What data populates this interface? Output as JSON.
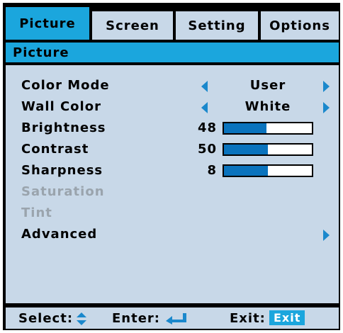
{
  "tabs": [
    {
      "label": "Picture",
      "active": true
    },
    {
      "label": "Screen",
      "active": false
    },
    {
      "label": "Setting",
      "active": false
    },
    {
      "label": "Options",
      "active": false
    }
  ],
  "section_title": "Picture",
  "items": [
    {
      "label": "Color Mode",
      "value": "User",
      "type": "select"
    },
    {
      "label": "Wall Color",
      "value": "White",
      "type": "select"
    },
    {
      "label": "Brightness",
      "value": "48",
      "level": 0.48,
      "type": "slider"
    },
    {
      "label": "Contrast",
      "value": "50",
      "level": 0.5,
      "type": "slider"
    },
    {
      "label": "Sharpness",
      "value": "8",
      "level": 0.5,
      "type": "slider"
    },
    {
      "label": "Saturation",
      "type": "disabled"
    },
    {
      "label": "Tint",
      "type": "disabled"
    },
    {
      "label": "Advanced",
      "type": "submenu"
    }
  ],
  "footer": {
    "select_label": "Select:",
    "enter_label": "Enter:",
    "exit_label": "Exit:",
    "exit_key": "Exit"
  },
  "colors": {
    "accent": "#1ba6dd",
    "panel": "#c8d8e8",
    "arrow": "#1a88cc",
    "bar_fill": "#0a73bd",
    "disabled_text": "#9aa4ad"
  },
  "icons": {
    "left": "triangle-left-icon",
    "right": "triangle-right-icon",
    "select": "up-down-arrows-icon",
    "enter": "enter-return-icon"
  }
}
